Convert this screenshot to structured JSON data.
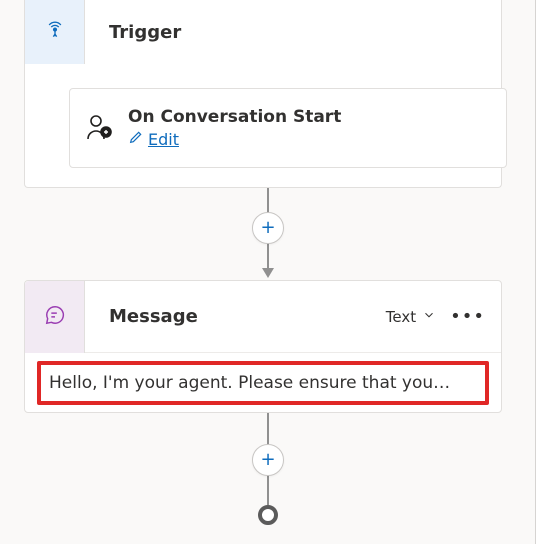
{
  "trigger": {
    "header_label": "Trigger",
    "event": {
      "title": "On Conversation Start",
      "edit_label": "Edit"
    }
  },
  "message": {
    "header_label": "Message",
    "output_type_label": "Text",
    "body_text": "Hello, I'm your agent. Please ensure that you…"
  },
  "icons": {
    "trigger": "antenna-icon",
    "conversation_start": "user-bubble-icon",
    "edit_pencil": "pencil-icon",
    "message": "chat-bubble-icon",
    "chevron_down": "chevron-down-icon",
    "add": "plus-icon",
    "more": "ellipsis-icon"
  },
  "colors": {
    "link": "#0f6cbd",
    "highlight_border": "#e02726",
    "trigger_accent_bg": "#e8f1fb",
    "message_accent_bg": "#f2eaf3"
  }
}
